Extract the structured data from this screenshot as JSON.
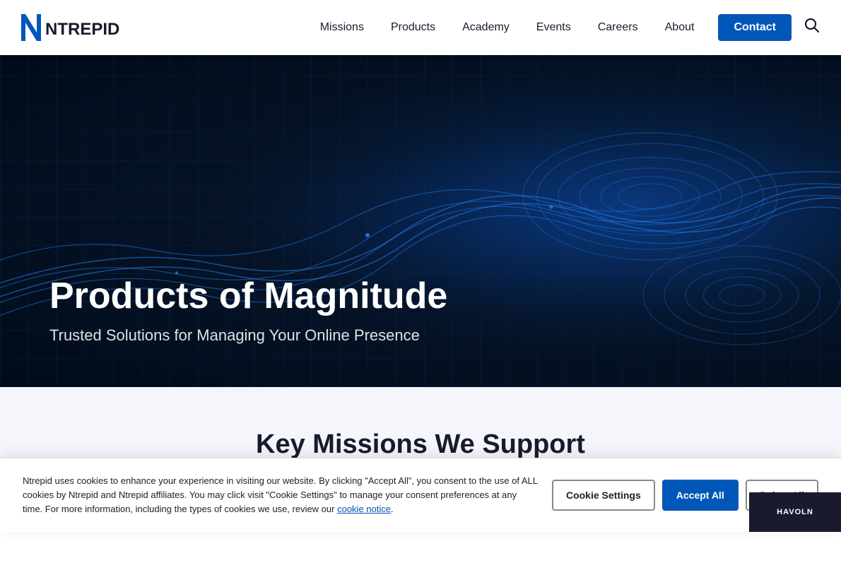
{
  "header": {
    "logo_alt": "Ntrepid",
    "nav_items": [
      {
        "label": "Missions",
        "id": "missions"
      },
      {
        "label": "Products",
        "id": "products"
      },
      {
        "label": "Academy",
        "id": "academy"
      },
      {
        "label": "Events",
        "id": "events"
      },
      {
        "label": "Careers",
        "id": "careers"
      },
      {
        "label": "About",
        "id": "about"
      }
    ],
    "contact_label": "Contact",
    "search_icon": "🔍"
  },
  "hero": {
    "title": "Products of Magnitude",
    "subtitle": "Trusted Solutions for Managing Your Online Presence"
  },
  "key_missions": {
    "title": "Key Missions We Support"
  },
  "cookie": {
    "text": "Ntrepid uses cookies to enhance your experience in visiting our website. By clicking \"Accept All\", you consent to the use of ALL cookies by Ntrepid and Ntrepid affiliates. You may click visit \"Cookie Settings\" to manage your consent preferences at any time. For more information, including the types of cookies we use, review our ",
    "link_text": "cookie notice",
    "text_end": ".",
    "settings_label": "Cookie Settings",
    "accept_label": "Accept All",
    "reject_label": "Reject All"
  },
  "watermark": {
    "label": "Havoln"
  }
}
